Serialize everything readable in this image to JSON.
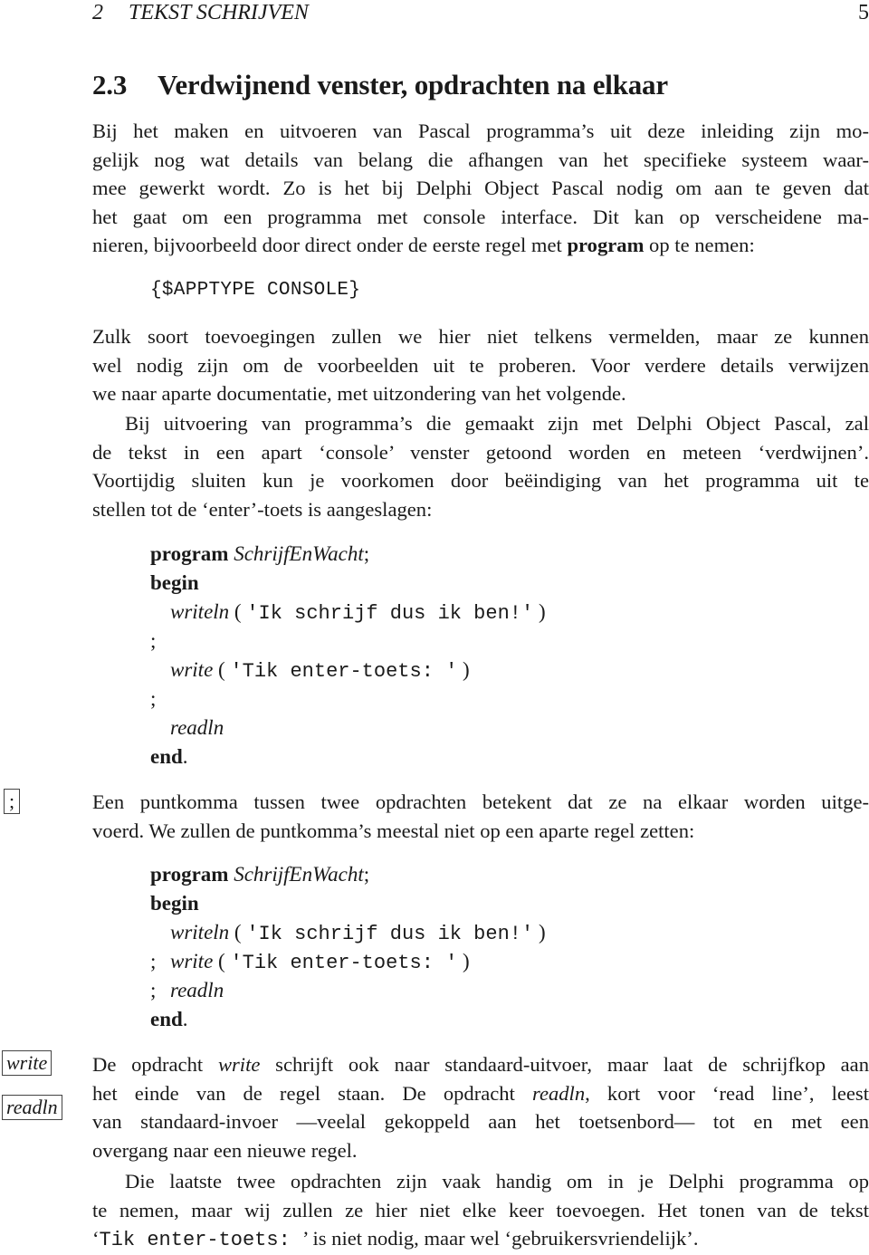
{
  "running_head": {
    "chapter_number": "2",
    "chapter_title": "TEKST SCHRIJVEN",
    "page_number": "5"
  },
  "section": {
    "number": "2.3",
    "title": "Verdwijnend venster, opdrachten na elkaar"
  },
  "paragraph1": {
    "lines": [
      "Bij het maken en uitvoeren van Pascal programma’s uit deze inleiding zijn mo-",
      "gelijk nog wat details van belang die afhangen van het specifieke systeem waar-",
      "mee gewerkt wordt. Zo is het bij Delphi Object Pascal nodig om aan te geven dat",
      "het gaat om een programma met console interface.  Dit kan op verscheidene ma-"
    ],
    "last_line_before": "nieren, bijvoorbeeld door direct onder de eerste regel met ",
    "last_line_bold": "program",
    "last_line_after": " op te nemen:"
  },
  "directive": "{$APPTYPE CONSOLE}",
  "paragraph2": {
    "lines": [
      "Zulk soort toevoegingen zullen we hier niet telkens vermelden, maar ze kunnen",
      "wel nodig zijn om de voorbeelden uit te proberen. Voor verdere details verwijzen",
      "we naar aparte documentatie, met uitzondering van het volgende."
    ]
  },
  "paragraph3": {
    "lines": [
      "Bij uitvoering van programma’s die gemaakt zijn met Delphi Object Pascal, zal",
      "de tekst in een apart ‘console’ venster getoond worden en meteen ‘verdwijnen’.",
      "Voortijdig sluiten kun je voorkomen door beëindiging van het programma uit te",
      "stellen tot de ‘enter’-toets is aangeslagen:"
    ]
  },
  "code1": {
    "program_kw": "program",
    "program_name": "SchrijfEnWacht",
    "semicolon": ";",
    "begin_kw": "begin",
    "writeln_id": "writeln",
    "writeln_arg": "'Ik schrijf dus ik ben!'",
    "write_id": "write",
    "write_arg": "'Tik enter-toets: '",
    "readln_id": "readln",
    "end_kw": "end",
    "period": ".",
    "open_paren": "(",
    "close_paren": ")"
  },
  "margin_notes": {
    "semicolon": ";",
    "write": "write",
    "readln": "readln"
  },
  "paragraph4": {
    "lines": [
      "Een puntkomma tussen twee opdrachten betekent dat ze na elkaar worden uitge-",
      "voerd. We zullen de puntkomma’s meestal niet op een aparte regel zetten:"
    ]
  },
  "paragraph5": {
    "l1_a": "De opdracht ",
    "l1_it": "write",
    "l1_b": " schrijft ook naar standaard-uitvoer, maar laat de schrijfkop aan",
    "l2_a": "het einde van de regel staan.  De opdracht ",
    "l2_it": "readln",
    "l2_b": ", kort voor ‘read line’, leest",
    "l3": "van standaard-invoer  —veelal gekoppeld aan het toetsenbord—  tot en met een",
    "l4": "overgang naar een nieuwe regel."
  },
  "paragraph6": {
    "lines": [
      "Die laatste twee opdrachten zijn vaak handig om in je Delphi programma op",
      "te nemen, maar wij zullen ze hier niet elke keer toevoegen. Het tonen van de tekst"
    ],
    "last_open_quote": "‘",
    "last_mono": "Tik enter-toets: ",
    "last_after": "’ is niet nodig, maar wel ‘gebruikersvriendelijk’."
  }
}
